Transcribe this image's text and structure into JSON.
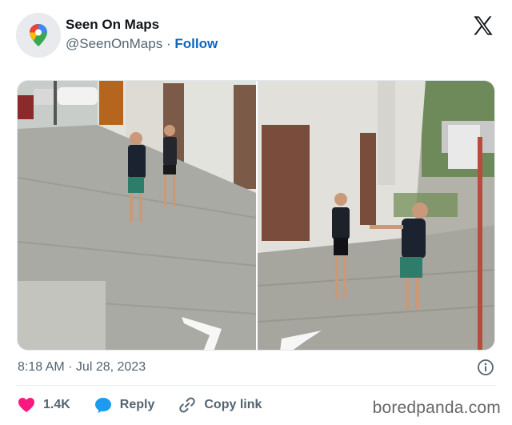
{
  "account": {
    "name": "Seen On Maps",
    "handle": "@SeenOnMaps",
    "separator": "·",
    "follow_label": "Follow"
  },
  "tweet": {
    "timestamp": "8:18 AM · Jul 28, 2023"
  },
  "actions": {
    "likes_count": "1.4K",
    "reply_label": "Reply",
    "copy_link_label": "Copy link"
  },
  "watermark": "boredpanda.com",
  "colors": {
    "like": "#f91880",
    "reply": "#1d9bf0",
    "follow": "#0a66c2"
  },
  "icons": {
    "avatar": "google-maps-pin-icon",
    "brand": "x-logo-icon",
    "info": "info-icon",
    "like": "heart-icon",
    "reply": "speech-bubble-icon",
    "copy": "link-icon"
  }
}
